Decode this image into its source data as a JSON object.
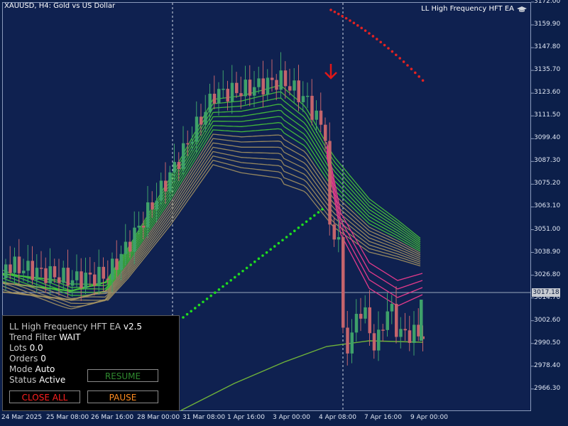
{
  "chart": {
    "symbol_title": "XAUUSD, H4:  Gold vs US Dollar",
    "ea_label": "LL High Frequency HFT EA",
    "current_price": "3017.18",
    "price_levels": [
      "3172.00",
      "3159.90",
      "3147.80",
      "3135.70",
      "3123.60",
      "3111.50",
      "3099.40",
      "3087.30",
      "3075.20",
      "3063.10",
      "3051.00",
      "3038.90",
      "3026.80",
      "3014.70",
      "3002.60",
      "2990.50",
      "2978.40",
      "2966.30"
    ],
    "time_labels": [
      "24 Mar 2025",
      "25 Mar 08:00",
      "26 Mar 16:00",
      "28 Mar 00:00",
      "31 Mar 08:00",
      "1 Apr 16:00",
      "3 Apr 00:00",
      "4 Apr 08:00",
      "7 Apr 16:00",
      "9 Apr 00:00"
    ],
    "colors": {
      "background": "#0f2150",
      "bull": "#3ea06a",
      "bear": "#c4646c",
      "ma_green": "#48c83a",
      "ma_tan": "#a49260",
      "ma_pink": "#e23a8a",
      "sar": "#e32222",
      "sar_green": "#1fdc1f"
    },
    "signal_icon": "down-arrow-icon"
  },
  "panel": {
    "title": "LL High Frequency HFT EA",
    "version": "v2.5",
    "trend_filter_label": "Trend Filter",
    "trend_filter_value": "WAIT",
    "lots_label": "Lots",
    "lots_value": "0.0",
    "orders_label": "Orders",
    "orders_value": "0",
    "mode_label": "Mode",
    "mode_value": "Auto",
    "status_label": "Status",
    "status_value": "Active",
    "resume_label": "RESUME",
    "close_all_label": "CLOSE ALL",
    "pause_label": "PAUSE",
    "colors": {
      "resume": "#2f8a2f",
      "close_all": "#ff2020",
      "pause": "#ff8c20"
    }
  }
}
